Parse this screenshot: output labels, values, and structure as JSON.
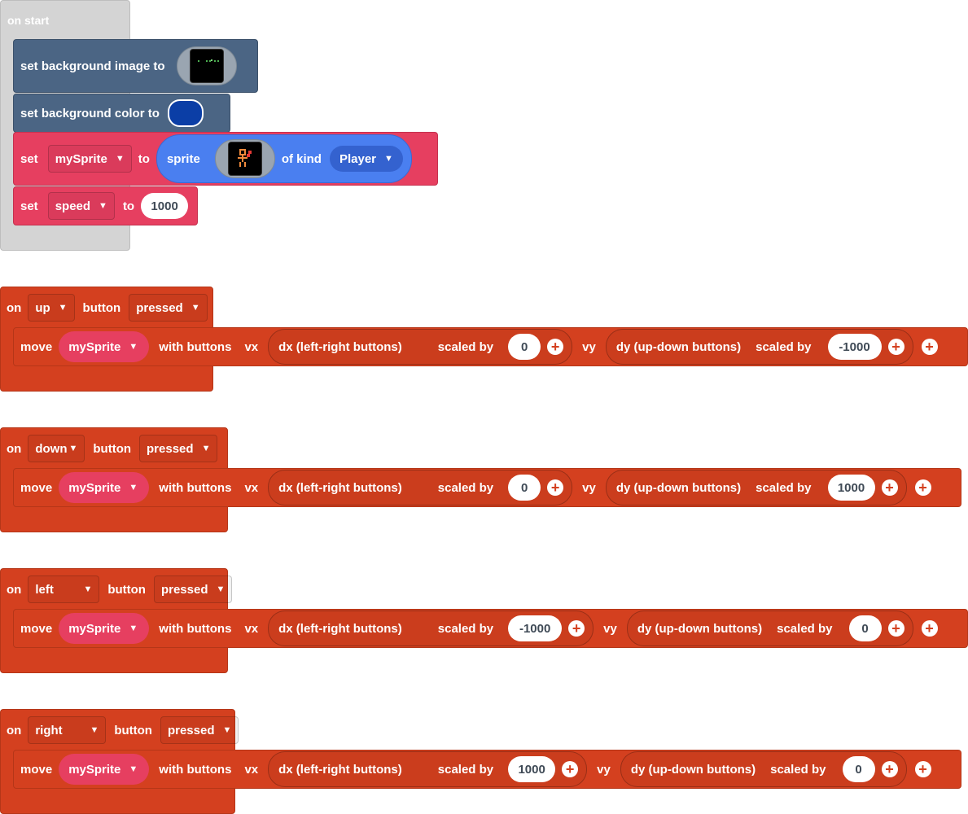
{
  "on_start": {
    "label": "on start",
    "set_bg_image": {
      "label": "set background image to",
      "image_icon": "background-image-thumbnail"
    },
    "set_bg_color": {
      "label": "set background color to",
      "color": "#0b3ea6"
    },
    "set_sprite": {
      "set": "set",
      "variable": "mySprite",
      "to": "to",
      "sprite_label": "sprite",
      "of_kind": "of kind",
      "kind": "Player",
      "image_icon": "player-sprite-thumbnail"
    },
    "set_speed": {
      "set": "set",
      "variable": "speed",
      "to": "to",
      "value": "1000"
    }
  },
  "events": [
    {
      "on": "on",
      "button": "up",
      "button_label": "button",
      "action": "pressed",
      "move": "move",
      "sprite": "mySprite",
      "with_buttons": "with buttons",
      "vx": "vx",
      "dx": "dx (left-right buttons)",
      "scaled_by": "scaled by",
      "vx_value": "0",
      "vy": "vy",
      "dy": "dy (up-down buttons)",
      "vy_value": "-1000"
    },
    {
      "on": "on",
      "button": "down",
      "button_label": "button",
      "action": "pressed",
      "move": "move",
      "sprite": "mySprite",
      "with_buttons": "with buttons",
      "vx": "vx",
      "dx": "dx (left-right buttons)",
      "scaled_by": "scaled by",
      "vx_value": "0",
      "vy": "vy",
      "dy": "dy (up-down buttons)",
      "vy_value": "1000"
    },
    {
      "on": "on",
      "button": "left",
      "button_label": "button",
      "action": "pressed",
      "move": "move",
      "sprite": "mySprite",
      "with_buttons": "with buttons",
      "vx": "vx",
      "dx": "dx (left-right buttons)",
      "scaled_by": "scaled by",
      "vx_value": "-1000",
      "vy": "vy",
      "dy": "dy (up-down buttons)",
      "vy_value": "0"
    },
    {
      "on": "on",
      "button": "right",
      "button_label": "button",
      "action": "pressed",
      "move": "move",
      "sprite": "mySprite",
      "with_buttons": "with buttons",
      "vx": "vx",
      "dx": "dx (left-right buttons)",
      "scaled_by": "scaled by",
      "vx_value": "1000",
      "vy": "vy",
      "dy": "dy (up-down buttons)",
      "vy_value": "0"
    }
  ],
  "colors": {
    "workspace": "#ffffff",
    "loops_grey": "#d4d4d4",
    "scene_blue": "#4b6584",
    "variables_red": "#e63f60",
    "sprites_blue": "#4a7ff0",
    "controller_orange": "#d4401f"
  }
}
